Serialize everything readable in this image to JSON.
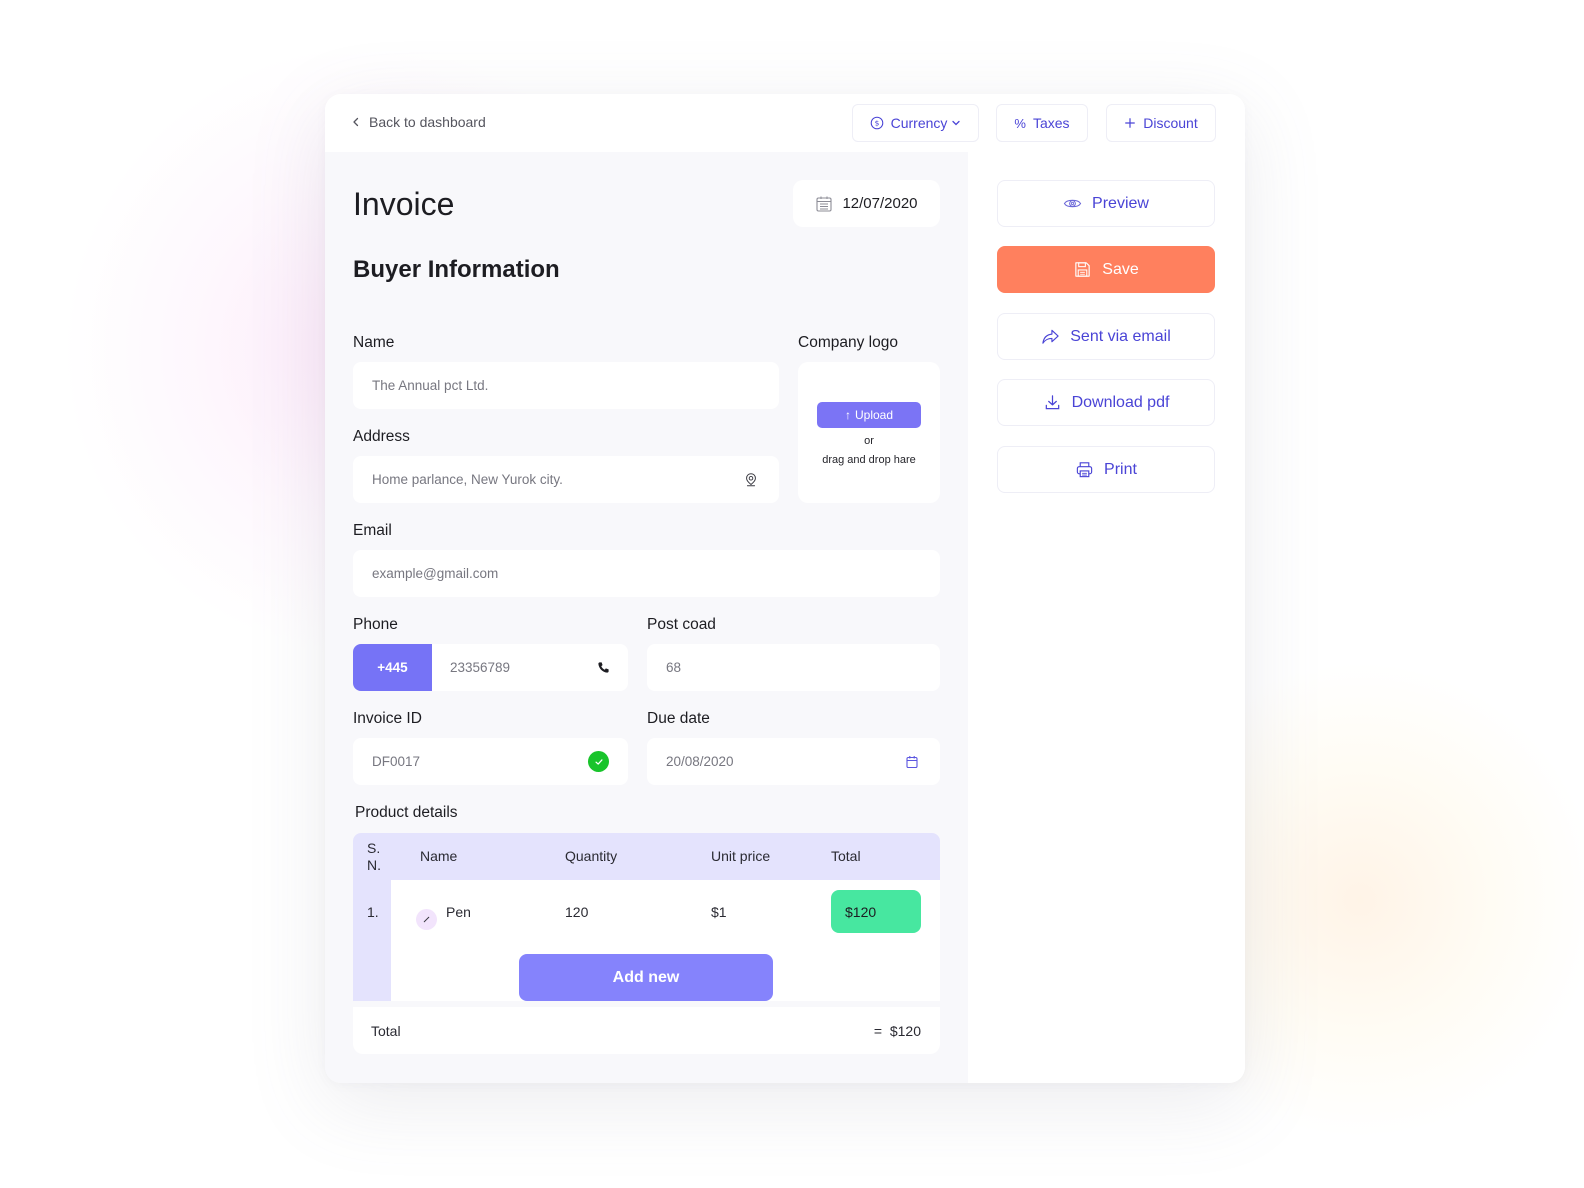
{
  "topbar": {
    "back_label": "Back to dashboard",
    "currency_label": "Currency",
    "taxes_label": "Taxes",
    "discount_label": "Discount"
  },
  "invoice": {
    "title": "Invoice",
    "date": "12/07/2020",
    "section_title": "Buyer Information"
  },
  "form": {
    "name": {
      "label": "Name",
      "value": "The Annual pct Ltd."
    },
    "address": {
      "label": "Address",
      "value": "Home parlance, New Yurok city."
    },
    "company_logo": {
      "label": "Company logo",
      "upload_label": "Upload",
      "or_text": "or",
      "drag_text": "drag and drop hare"
    },
    "email": {
      "label": "Email",
      "placeholder": "example@gmail.com"
    },
    "phone": {
      "label": "Phone",
      "code": "+445",
      "value": "23356789"
    },
    "post_code": {
      "label": "Post coad",
      "value": "68"
    },
    "invoice_id": {
      "label": "Invoice ID",
      "value": "DF0017"
    },
    "due_date": {
      "label": "Due date",
      "value": "20/08/2020"
    }
  },
  "products": {
    "title": "Product details",
    "headers": {
      "sn": "S. N.",
      "name": "Name",
      "quantity": "Quantity",
      "unit_price": "Unit price",
      "total": "Total"
    },
    "rows": [
      {
        "sn": "1.",
        "name": "Pen",
        "quantity": "120",
        "unit_price": "$1",
        "total": "$120"
      }
    ],
    "add_new_label": "Add new",
    "total_label": "Total",
    "total_value": "=  $120"
  },
  "actions": {
    "preview": "Preview",
    "save": "Save",
    "email": "Sent via email",
    "download": "Download pdf",
    "print": "Print"
  },
  "colors": {
    "accent": "#4a44d6",
    "primary_button": "#8583fc",
    "save_button": "#ff805e",
    "total_badge": "#47e7a0",
    "table_header": "#e4e3fd",
    "check_green": "#19c42b"
  }
}
